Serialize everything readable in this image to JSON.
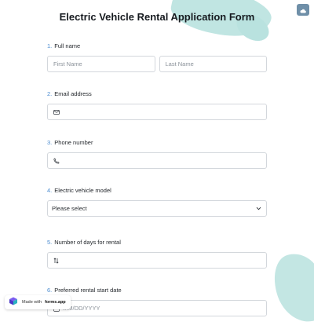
{
  "form": {
    "title": "Electric Vehicle Rental Application Form"
  },
  "questions": [
    {
      "number": "1.",
      "label": "Full name",
      "first_placeholder": "First Name",
      "last_placeholder": "Last Name"
    },
    {
      "number": "2.",
      "label": "Email address",
      "icon": "envelope-icon"
    },
    {
      "number": "3.",
      "label": "Phone number",
      "icon": "phone-icon"
    },
    {
      "number": "4.",
      "label": "Electric vehicle model",
      "selected": "Please select",
      "icon": "chevron-down-icon"
    },
    {
      "number": "5.",
      "label": "Number of days for rental",
      "icon": "sort-arrows-icon"
    },
    {
      "number": "6.",
      "label": "Preferred rental start date",
      "placeholder": "MM/DD/YYYY",
      "icon": "calendar-icon"
    }
  ],
  "badge": {
    "prefix": "Made with",
    "brand": "forms.app"
  },
  "colors": {
    "accent": "#4a8bd0",
    "brush": "#b9e2df",
    "corner_button": "#6f8fa8"
  }
}
